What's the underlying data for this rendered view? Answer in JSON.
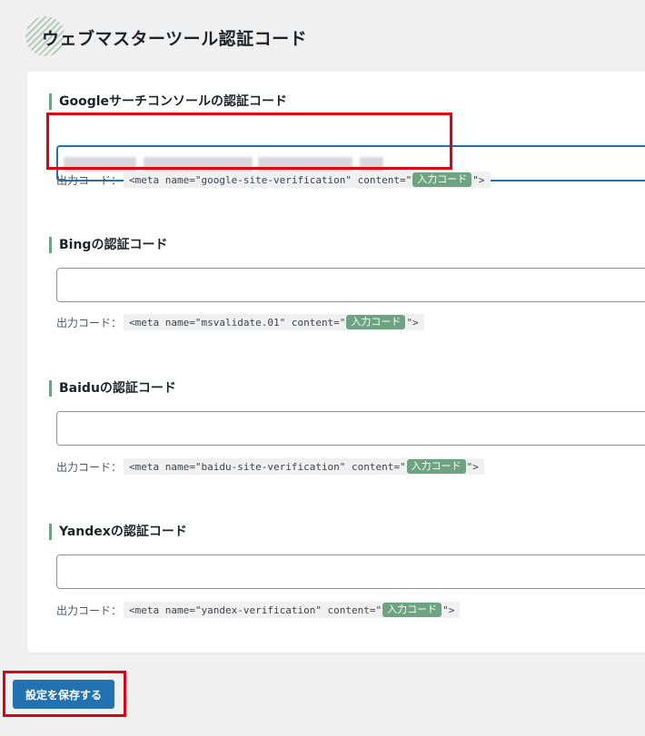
{
  "header": {
    "title": "ウェブマスターツール認証コード",
    "deco_icon": "striped-circle-icon"
  },
  "output_label": "出力コード：",
  "badge_text": "入力コード",
  "sections": [
    {
      "title": "Googleサーチコンソールの認証コード",
      "value": "",
      "value_obscured": true,
      "code_prefix": "<meta name=\"google-site-verification\" content=\"",
      "code_suffix": "\">"
    },
    {
      "title": "Bingの認証コード",
      "value": "",
      "code_prefix": "<meta name=\"msvalidate.01\" content=\"",
      "code_suffix": "\">"
    },
    {
      "title": "Baiduの認証コード",
      "value": "",
      "code_prefix": "<meta name=\"baidu-site-verification\" content=\"",
      "code_suffix": "\">"
    },
    {
      "title": "Yandexの認証コード",
      "value": "",
      "code_prefix": "<meta name=\"yandex-verification\" content=\"",
      "code_suffix": "\">"
    }
  ],
  "save_button": {
    "label": "設定を保存する"
  },
  "colors": {
    "accent_green": "#6ea382",
    "button_blue": "#2271b1",
    "highlight_red": "#e0000f",
    "background": "#f0f0f1"
  }
}
